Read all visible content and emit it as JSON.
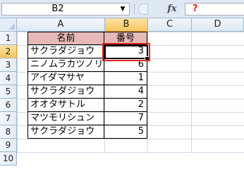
{
  "formula_bar": {
    "name_box": "B2",
    "name_box_arrow": "▼",
    "fx_label": "fx",
    "formula_value": "?"
  },
  "columns": [
    "A",
    "B",
    "C",
    "D"
  ],
  "active_column": "B",
  "rows": [
    "1",
    "2",
    "3",
    "4",
    "5",
    "6",
    "7",
    "8",
    "9",
    "10"
  ],
  "active_row": "2",
  "table": {
    "header": {
      "name": "名前",
      "number": "番号"
    },
    "records": [
      {
        "name": "サクラダジョウ",
        "number": "3"
      },
      {
        "name": "ニノムラカツノリ",
        "number": "6"
      },
      {
        "name": "アイダマサヤ",
        "number": "1"
      },
      {
        "name": "サクラダジョウ",
        "number": "4"
      },
      {
        "name": "オオタサトル",
        "number": "2"
      },
      {
        "name": "マツモリシュン",
        "number": "7"
      },
      {
        "name": "サクラダジョウ",
        "number": "5"
      }
    ]
  },
  "colors": {
    "header_fill": "#e6b9b8",
    "highlight": "#e0281e",
    "active_header": "#f6c560"
  }
}
